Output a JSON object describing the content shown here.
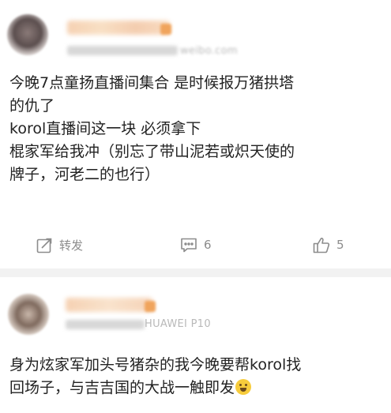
{
  "post1": {
    "source": "weibo.com",
    "content_lines": [
      "今晚7点童扬直播间集合 是时候报万猪拱塔",
      "的仇了",
      "korol直播间这一块 必须拿下",
      "棍家军给我冲（别忘了带山泥若或炽天使的",
      "牌子，河老二的也行）"
    ],
    "actions": {
      "repost_label": "转发",
      "comment_count": "6",
      "like_count": "5"
    }
  },
  "post2": {
    "source": "HUAWEI P10",
    "content_lines": [
      "身为炫家军加头号猪杂的我今晚要帮korol找",
      "回场子，与吉吉国的大战一触即发"
    ],
    "emoji": "face-emoji"
  },
  "colors": {
    "text": "#222222",
    "meta": "#8c8c8c",
    "divider": "#f2f2f2",
    "name_blur": "#f3c6a0"
  }
}
